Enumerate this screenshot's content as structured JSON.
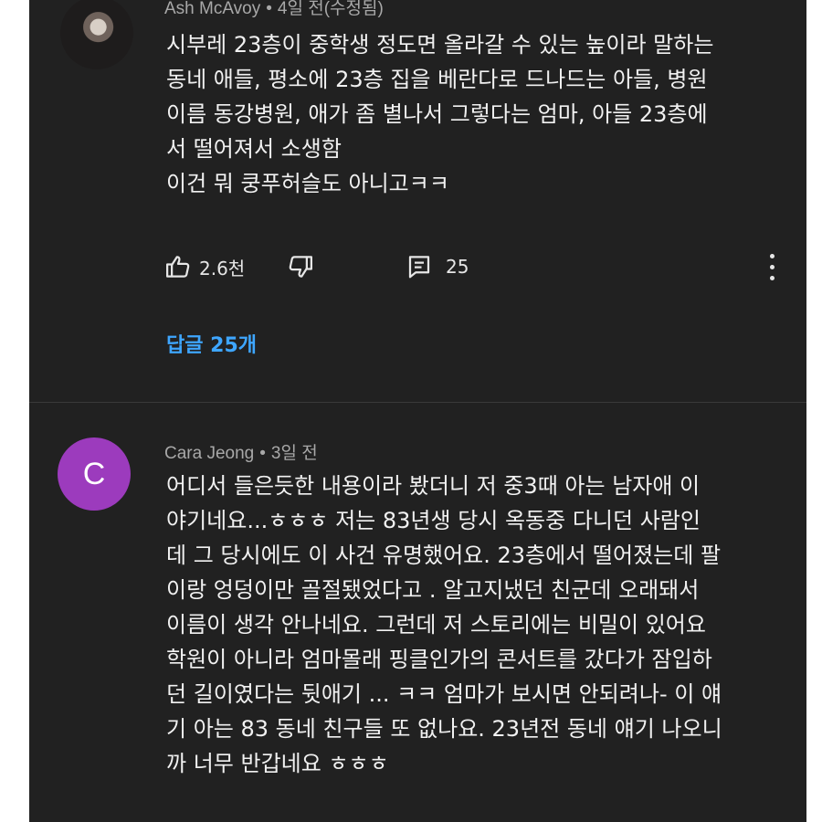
{
  "comments": [
    {
      "author": "Ash McAvoy",
      "separator": "•",
      "time": "4일 전(수정됨)",
      "avatar_icon": "profile-photo",
      "lines": [
        "시부레 23층이 중학생 정도면 올라갈 수 있는 높이라 말하는",
        "동네 애들, 평소에 23층 집을 베란다로 드나드는 아들, 병원",
        "이름 동강병원, 애가 좀 별나서 그렇다는 엄마, 아들 23층에",
        "서 떨어져서 소생함",
        "이건 뭐 쿵푸허슬도 아니고ㅋㅋ"
      ],
      "likes": "2.6천",
      "reply_count": "25",
      "replies_link": "답글 25개"
    },
    {
      "author": "Cara Jeong",
      "separator": "•",
      "time": "3일 전",
      "avatar_letter": "C",
      "avatar_color": "#9c3bbd",
      "lines": [
        "어디서 들은듯한 내용이라 봤더니 저 중3때 아는 남자애 이",
        "야기네요...ㅎㅎㅎ 저는 83년생 당시 옥동중 다니던 사람인",
        "데 그 당시에도 이 사건 유명했어요. 23층에서 떨어졌는데 팔",
        "이랑 엉덩이만 골절됐었다고 . 알고지냈던 친군데 오래돼서",
        "이름이 생각 안나네요. 그런데 저 스토리에는 비밀이 있어요",
        "학원이 아니라 엄마몰래 핑클인가의 콘서트를 갔다가 잠입하",
        "던 길이였다는 뒷애기 ... ㅋㅋ 엄마가 보시면 안되려나- 이 얘",
        "기 아는 83 동네 친구들 또 없나요. 23년전 동네 얘기 나오니",
        "까 너무 반갑네요 ㅎㅎㅎ"
      ]
    }
  ],
  "colors": {
    "background": "#212121",
    "text": "#f1f1f1",
    "meta": "#a8a8a8",
    "link": "#3ea6ff"
  }
}
